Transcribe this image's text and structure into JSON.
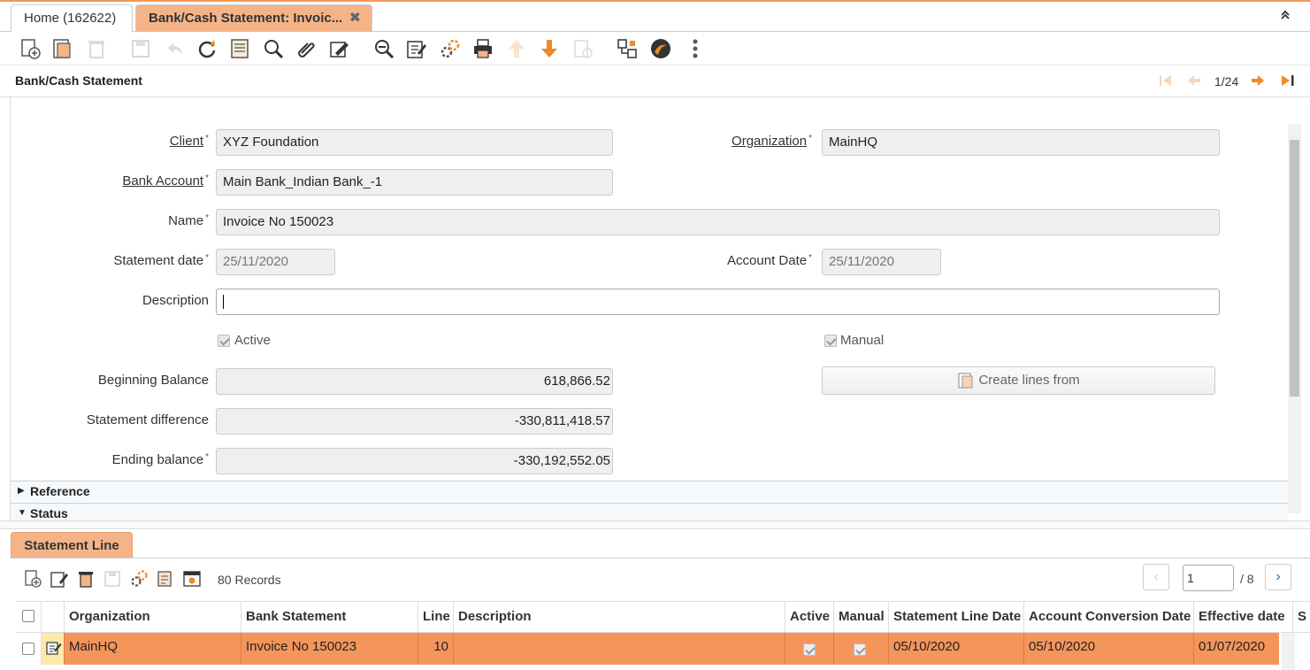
{
  "tabs": [
    {
      "label": "Home (162622)"
    },
    {
      "label": "Bank/Cash Statement: Invoic...",
      "close": "✖"
    }
  ],
  "collapse_glyph": "⌃",
  "toolbar_icons": [
    "new-record-icon",
    "copy-record-icon",
    "delete-icon",
    "save-icon",
    "undo-icon",
    "refresh-icon",
    "grid-toggle-icon",
    "find-icon",
    "attachment-icon",
    "chat-icon",
    "zoom-across-icon",
    "edit-icon",
    "process-icon",
    "print-icon",
    "previous-record-icon",
    "next-record-icon",
    "post-icon",
    "workflow-icon",
    "help-icon",
    "more-icon"
  ],
  "title": "Bank/Cash Statement",
  "navigation": {
    "position": "1/24"
  },
  "form": {
    "client": {
      "label": "Client",
      "value": "XYZ Foundation"
    },
    "organization": {
      "label": "Organization",
      "value": "MainHQ"
    },
    "bank_account": {
      "label": "Bank Account",
      "value": "Main Bank_Indian Bank_-1"
    },
    "name": {
      "label": "Name",
      "value": "Invoice No 150023"
    },
    "statement_date": {
      "label": "Statement date",
      "value": "25/11/2020"
    },
    "account_date": {
      "label": "Account Date",
      "value": "25/11/2020"
    },
    "description": {
      "label": "Description",
      "value": ""
    },
    "active": {
      "label": "Active",
      "checked": true
    },
    "manual": {
      "label": "Manual",
      "checked": true
    },
    "beginning_balance": {
      "label": "Beginning Balance",
      "value": "618,866.52"
    },
    "statement_difference": {
      "label": "Statement difference",
      "value": "-330,811,418.57"
    },
    "ending_balance": {
      "label": "Ending balance",
      "value": "-330,192,552.05"
    },
    "create_lines_button": "Create lines from"
  },
  "sections": [
    {
      "label": "Reference",
      "expanded": false
    },
    {
      "label": "Status",
      "expanded": true
    }
  ],
  "subtab": {
    "label": "Statement Line"
  },
  "grid": {
    "records": "80 Records",
    "page": "1",
    "page_total": "/ 8",
    "columns": [
      "Organization",
      "Bank Statement",
      "Line",
      "Description",
      "Active",
      "Manual",
      "Statement Line Date",
      "Account Conversion Date",
      "Effective date",
      "S"
    ],
    "rows": [
      {
        "organization": "MainHQ",
        "bank_statement": "Invoice No 150023",
        "line": "10",
        "description": "",
        "active": true,
        "manual": true,
        "statement_line_date": "05/10/2020",
        "account_conversion_date": "05/10/2020",
        "effective_date": "01/07/2020"
      }
    ]
  },
  "colors": {
    "accent": "#f39a53",
    "selected_row": "#f4955c",
    "tab_active": "#f5b488"
  }
}
